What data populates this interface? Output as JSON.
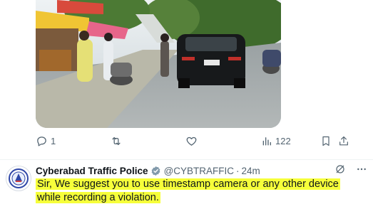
{
  "tweet": {
    "actions": {
      "replies": "1",
      "reposts": "",
      "likes": "",
      "views": "122"
    }
  },
  "reply": {
    "author": {
      "display_name": "Cyberabad Traffic Police",
      "handle": "@CYBTRAFFIC",
      "separator": "·",
      "time": "24m",
      "verified": true
    },
    "text": "Sir, We suggest you to use timestamp camera or any other device while recording a violation.",
    "highlight_color": "#f6ff3a"
  },
  "colors": {
    "text_primary": "#0f1419",
    "text_secondary": "#536471",
    "verified_badge": "#829aab"
  },
  "icons": {
    "reply": "reply-icon",
    "repost": "repost-icon",
    "like": "heart-icon",
    "views": "views-chart-icon",
    "bookmark": "bookmark-icon",
    "share": "share-icon",
    "grok": "grok-icon",
    "more": "more-icon",
    "verified": "verified-badge-icon"
  }
}
